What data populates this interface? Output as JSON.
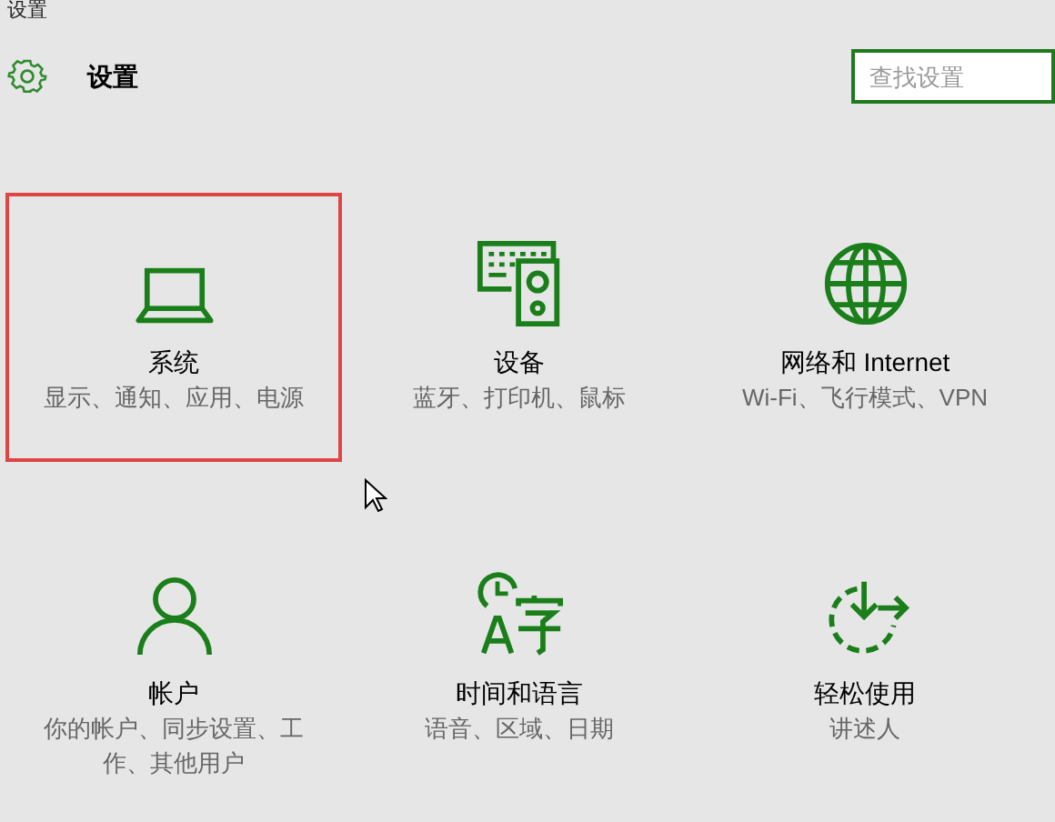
{
  "window": {
    "title": "设置"
  },
  "header": {
    "title": "设置"
  },
  "search": {
    "placeholder": "查找设置"
  },
  "tiles": [
    {
      "kind": "system",
      "title": "系统",
      "description": "显示、通知、应用、电源",
      "selected": true
    },
    {
      "kind": "devices",
      "title": "设备",
      "description": "蓝牙、打印机、鼠标",
      "selected": false
    },
    {
      "kind": "network",
      "title": "网络和 Internet",
      "description": "Wi-Fi、飞行模式、VPN",
      "selected": false
    },
    {
      "kind": "accounts",
      "title": "帐户",
      "description": "你的帐户、同步设置、工作、其他用户",
      "selected": false
    },
    {
      "kind": "time",
      "title": "时间和语言",
      "description": "语音、区域、日期",
      "selected": false
    },
    {
      "kind": "ease",
      "title": "轻松使用",
      "description": "讲述人",
      "selected": false
    }
  ]
}
